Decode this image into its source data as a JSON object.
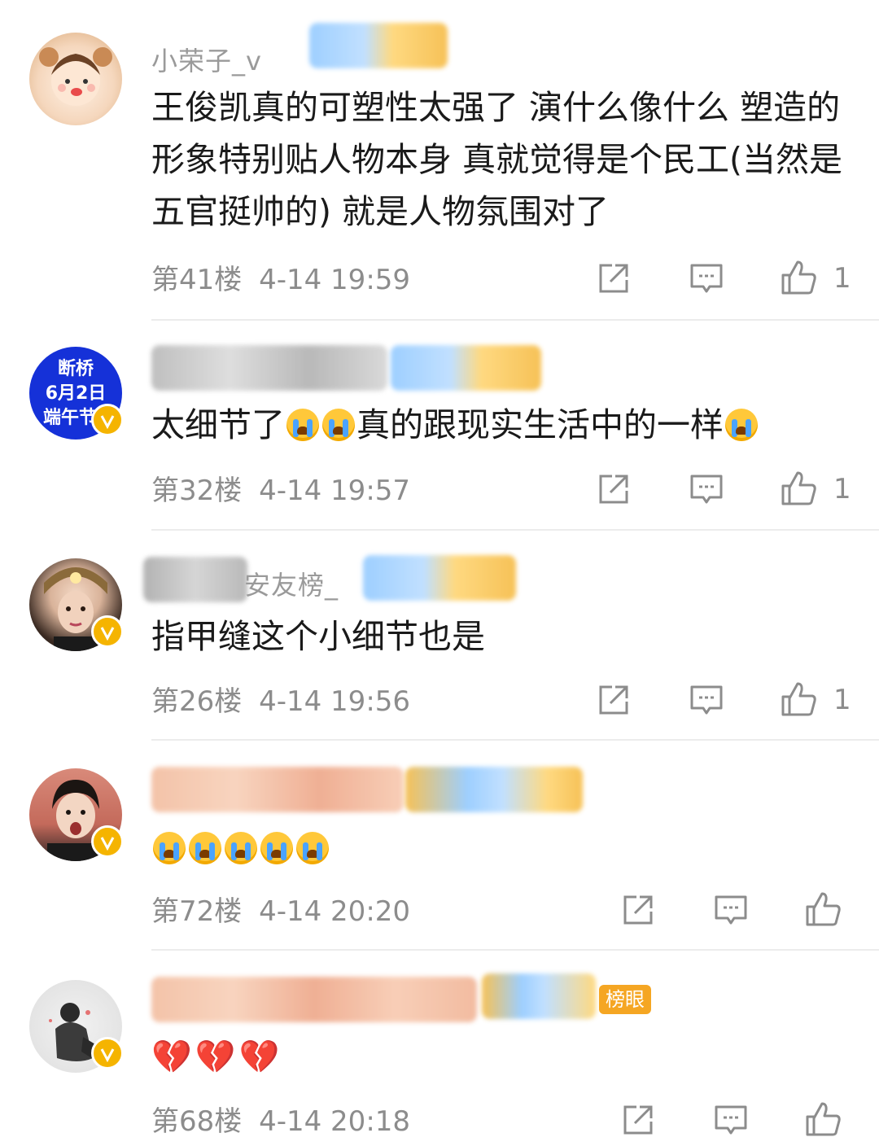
{
  "comments": [
    {
      "username_visible": "小荣子_v",
      "content": "王俊凯真的可塑性太强了 演什么像什么 塑造的形象特别贴人物本身 真就觉得是个民工(当然是五官挺帅的) 就是人物氛围对了",
      "floor": "第41楼",
      "time": "4-14 19:59",
      "likes": "1"
    },
    {
      "avatar_text": [
        "断桥",
        "6月2日",
        "端午节"
      ],
      "content_parts": [
        "太细节了",
        "真的跟现实生活中的一样"
      ],
      "floor": "第32楼",
      "time": "4-14 19:57",
      "likes": "1"
    },
    {
      "username_visible": "安友榜_",
      "content": "指甲缝这个小细节也是",
      "floor": "第26楼",
      "time": "4-14 19:56",
      "likes": "1"
    },
    {
      "content_emoji_count": 5,
      "floor": "第72楼",
      "time": "4-14 20:20",
      "likes": ""
    },
    {
      "badge": "榜眼",
      "content_hearts": 3,
      "floor": "第68楼",
      "time": "4-14 20:18",
      "likes": ""
    }
  ],
  "icons": {
    "share": "share-icon",
    "reply": "comment-icon",
    "like": "thumbs-up-icon"
  },
  "colors": {
    "accent_badge": "#f5b400",
    "tag": "#f5a623",
    "meta_text": "#8c8c8c"
  }
}
